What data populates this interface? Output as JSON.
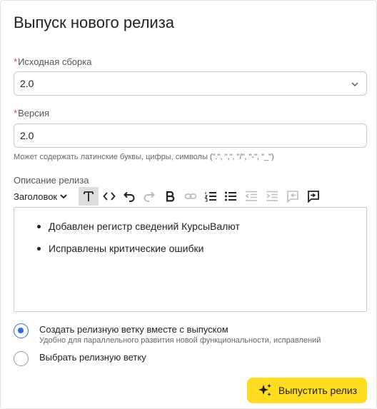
{
  "dialog": {
    "title": "Выпуск нового релиза"
  },
  "source_build": {
    "required_mark": "*",
    "label": "Исходная сборка",
    "value": "2.0"
  },
  "version": {
    "required_mark": "*",
    "label": "Версия",
    "value": "2.0",
    "hint": "Может содержать латинские буквы, цифры, символы (\".\", \",\", \"/\", \"-\", \"_\")"
  },
  "description": {
    "label": "Описание релиза",
    "toolbar": {
      "heading_select": "Заголовок",
      "icons": [
        "text-format-icon",
        "code-icon",
        "undo-icon",
        "redo-icon",
        "bold-icon",
        "link-icon",
        "ordered-list-icon",
        "bullet-list-icon",
        "outdent-icon",
        "indent-icon",
        "comment-icon",
        "comment-add-icon"
      ]
    },
    "items": [
      "Добавлен регистр сведений КурсыВалют",
      "Исправлены критические ошибки"
    ]
  },
  "options": [
    {
      "label": "Создать релизную ветку вместе с выпуском",
      "sublabel": "Удобно для параллельного развития новой функциональности, исправлений",
      "selected": true
    },
    {
      "label": "Выбрать релизную ветку",
      "selected": false
    }
  ],
  "actions": {
    "release_button": "Выпустить релиз",
    "release_button_color": "#ffdc1f"
  },
  "colors": {
    "accent": "#2b6fd6",
    "required": "#e5484d"
  }
}
